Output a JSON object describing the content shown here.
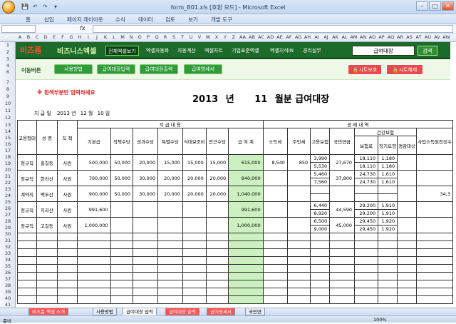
{
  "window": {
    "title": "form_B01.xls [호환 모드] - Microsoft Excel"
  },
  "menu": [
    "홈",
    "삽입",
    "페이지 레이아웃",
    "수식",
    "데이터",
    "검토",
    "보기",
    "개발 도구"
  ],
  "formula": {
    "fx": "fx",
    "name": ""
  },
  "columns": [
    "A",
    "B",
    "C",
    "D",
    "E",
    "F",
    "G",
    "H",
    "I",
    "J",
    "K",
    "L",
    "M",
    "N",
    "O",
    "P",
    "Q",
    "R",
    "S",
    "T",
    "U",
    "V",
    "W",
    "X",
    "Y",
    "Z",
    "AA",
    "AB",
    "AC",
    "AD",
    "AE",
    "AF",
    "AG",
    "AH",
    "AI",
    "AJ",
    "AK",
    "AL",
    "AM",
    "AN",
    "AO",
    "AP",
    "AQ",
    "AR",
    "AS",
    "AT",
    "AU",
    "AV",
    "AW"
  ],
  "rows": [
    "1",
    "2",
    "3",
    "4",
    "6",
    "7",
    "8",
    "9",
    "10",
    "11",
    "12",
    "13",
    "14",
    "15",
    "16",
    "17",
    "18",
    "19",
    "20",
    "21",
    "22",
    "23",
    "24",
    "25",
    "26",
    "27",
    "28",
    "29",
    "30",
    "31",
    "32",
    "33",
    "34",
    "35",
    "36",
    "37",
    "38",
    "39",
    "40",
    "41"
  ],
  "banner": {
    "logo1": "비즈폼",
    "logo2": "비즈니스엑셀",
    "nav": [
      "전체엑셀보기",
      "엑셀자동화",
      "자동계산",
      "엑셀차트",
      "기업표준엑셀",
      "엑셀지식iN",
      "경리실무"
    ],
    "current": "급여대장",
    "go": "검색"
  },
  "tools": {
    "label": "이동버튼",
    "buttons": [
      "사용방법",
      "급여대장입력",
      "급여대장출력",
      "급여명세서"
    ],
    "protect": "시트보호",
    "unprotect": "시트해제"
  },
  "note": "※ 흰색부분만 입력하세요",
  "title": {
    "year": "2013",
    "year_unit": "년",
    "month": "11",
    "suffix": "월분 급여대장"
  },
  "date": {
    "label": "지 급 일",
    "year": "2013",
    "y": "년",
    "month": "12",
    "m": "월",
    "day": "10",
    "d": "일"
  },
  "headers": {
    "type": "고용형태",
    "name": "성 명",
    "rank": "직 책",
    "pay_group": "지 급 내 용",
    "base": "기본급",
    "role": "직책수당",
    "perf": "성과수당",
    "special": "특별수당",
    "meal": "식대보조비",
    "overtime": "만근수당",
    "total": "급 여 계",
    "ded_group": "공 제 내 역",
    "income_tax": "소득세",
    "resident_tax": "주민세",
    "emp_ins": "고용보험",
    "pension": "국민연금",
    "health": "건강보험",
    "health_fee": "보험료",
    "ltc": "장기요양",
    "ltc2": "경감대상",
    "biz": "사업소득원천징수"
  },
  "employees": [
    {
      "type": "정규직",
      "name": "홍길동",
      "rank": "사원",
      "base": "500,000",
      "role": "50,000",
      "perf": "20,000",
      "special": "15,000",
      "meal": "15,000",
      "overtime": "15,000",
      "total": "615,000",
      "income_tax": "8,540",
      "resident_tax": "850",
      "emp1": "3,990",
      "emp2": "5,530",
      "pension": "27,670",
      "h1": "18,110",
      "h1b": "1,180",
      "h2": "18,110",
      "h2b": "1,180",
      "biz": ""
    },
    {
      "type": "정규직",
      "name": "한라산",
      "rank": "사원",
      "base": "700,000",
      "role": "50,000",
      "perf": "30,000",
      "special": "20,000",
      "meal": "20,000",
      "overtime": "20,000",
      "total": "840,000",
      "income_tax": "",
      "resident_tax": "",
      "emp1": "5,460",
      "emp2": "7,560",
      "pension": "37,800",
      "h1": "24,730",
      "h1b": "1,610",
      "h2": "24,730",
      "h2b": "1,610",
      "biz": ""
    },
    {
      "type": "계약직",
      "name": "백두산",
      "rank": "사원",
      "base": "900,000",
      "role": "50,000",
      "perf": "30,000",
      "special": "20,000",
      "meal": "20,000",
      "overtime": "20,000",
      "total": "1,040,000",
      "income_tax": "",
      "resident_tax": "",
      "emp1": "",
      "emp2": "",
      "pension": "",
      "h1": "",
      "h1b": "",
      "h2": "",
      "h2b": "",
      "biz": "34,3"
    },
    {
      "type": "정규직",
      "name": "지리산",
      "rank": "사원",
      "base": "991,600",
      "role": "",
      "perf": "",
      "special": "",
      "meal": "",
      "overtime": "",
      "total": "991,600",
      "income_tax": "",
      "resident_tax": "",
      "emp1": "6,440",
      "emp2": "8,920",
      "pension": "44,590",
      "h1": "29,200",
      "h1b": "1,910",
      "h2": "29,200",
      "h2b": "1,910",
      "biz": ""
    },
    {
      "type": "정규직",
      "name": "고길동",
      "rank": "사원",
      "base": "1,000,000",
      "role": "",
      "perf": "",
      "special": "",
      "meal": "",
      "overtime": "",
      "total": "1,000,000",
      "income_tax": "",
      "resident_tax": "",
      "emp1": "6,500",
      "emp2": "9,000",
      "pension": "45,000",
      "h1": "29,450",
      "h1b": "1,920",
      "h2": "29,450",
      "h2b": "1,920",
      "biz": ""
    }
  ],
  "sheets": [
    "비즈폼 엑셀 소개",
    "사용방법",
    "급여대장 입력",
    "급여대장 출력",
    "급여명세서",
    "국민연"
  ],
  "status": {
    "ready": "준비",
    "zoom": "100%"
  }
}
